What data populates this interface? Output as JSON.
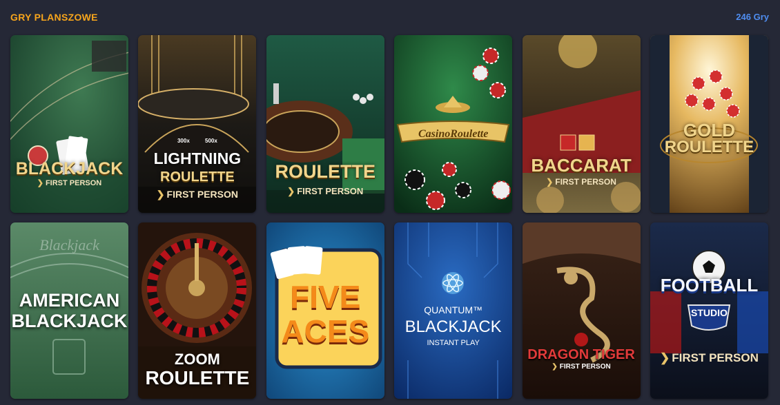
{
  "header": {
    "title": "GRY PLANSZOWE",
    "count": "246 Gry"
  },
  "games": [
    {
      "title": "BLACKJACK",
      "subtitle": "FIRST PERSON"
    },
    {
      "title_line1": "LIGHTNING",
      "title_line2": "ROULETTE",
      "subtitle": "FIRST PERSON",
      "badge_left": "300x",
      "badge_right": "500x"
    },
    {
      "title": "ROULETTE",
      "subtitle": "FIRST PERSON"
    },
    {
      "title": "CasinoRoulette"
    },
    {
      "title": "BACCARAT",
      "subtitle": "FIRST PERSON"
    },
    {
      "title_line1": "GOLD",
      "title_line2": "ROULETTE"
    },
    {
      "title_line1": "AMERICAN",
      "title_line2": "BLACKJACK",
      "bg_text": "Blackjack"
    },
    {
      "title_line1": "ZOOM",
      "title_line2": "ROULETTE"
    },
    {
      "title_line1": "FIVE",
      "title_line2": "ACES"
    },
    {
      "title_line1": "QUANTUM™",
      "title_line2": "BLACKJACK",
      "subtitle": "INSTANT PLAY"
    },
    {
      "title": "DRAGON TIGER",
      "subtitle": "FIRST PERSON"
    },
    {
      "title_line1": "FOOTBALL",
      "title_line2": "STUDIO",
      "subtitle": "FIRST PERSON"
    }
  ]
}
